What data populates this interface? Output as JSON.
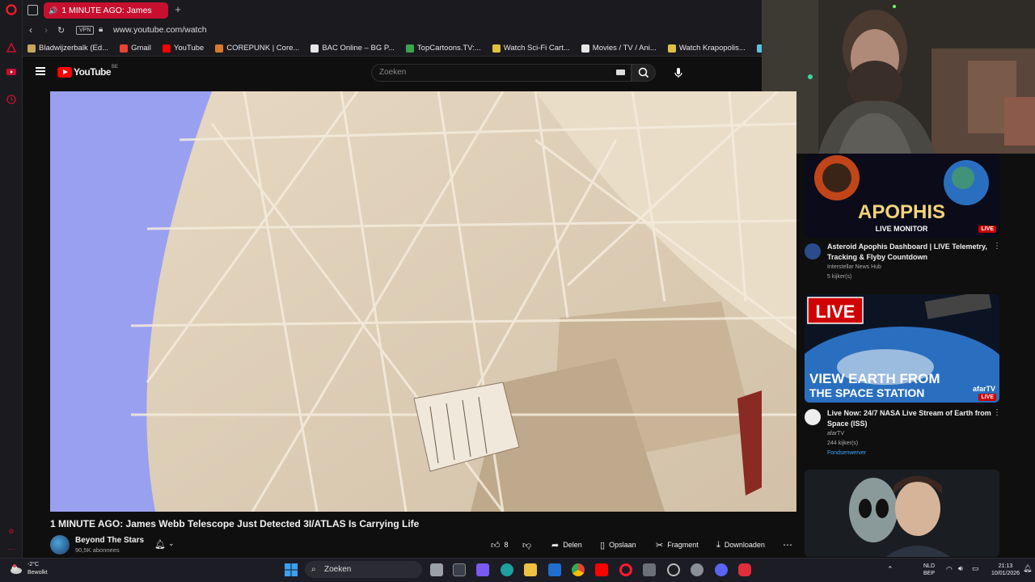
{
  "browser": {
    "active_tab_title": "1 MINUTE AGO: James",
    "new_tab_label": "+",
    "url": "www.youtube.com/watch",
    "vpn_label": "VPN"
  },
  "bookmarks": [
    {
      "label": "Bladwijzerbalk (Ed...",
      "color": "#c9a55c"
    },
    {
      "label": "Gmail",
      "color": "#ea4335"
    },
    {
      "label": "YouTube",
      "color": "#ff0000"
    },
    {
      "label": "COREPUNK | Core...",
      "color": "#d87a2a"
    },
    {
      "label": "BAC Online – BG P...",
      "color": "#e6e6e6"
    },
    {
      "label": "TopCartoons.TV:...",
      "color": "#3aa64c"
    },
    {
      "label": "Watch Sci-Fi Cart...",
      "color": "#e0c040"
    },
    {
      "label": "Movies / TV / Ani...",
      "color": "#e6e6e6"
    },
    {
      "label": "Watch Krapopolis...",
      "color": "#e0c040"
    },
    {
      "label": "Zamnesia | Het Be",
      "color": "#5cc0e0"
    }
  ],
  "youtube": {
    "logo_text": "YouTube",
    "region": "BE",
    "search_placeholder": "Zoeken"
  },
  "video": {
    "title": "1 MINUTE AGO: James Webb Telescope Just Detected 3I/ATLAS Is Carrying Life",
    "channel_name": "Beyond The Stars",
    "subscribers": "90,5K abonnees",
    "likes": "8",
    "actions": {
      "share": "Delen",
      "save": "Opslaan",
      "clip": "Fragment",
      "download": "Downloaden"
    }
  },
  "recommendations": [
    {
      "thumb_text": "APOPHIS",
      "thumb_subtext": "LIVE MONITOR",
      "live_label": "LIVE",
      "title": "Asteroid Apophis Dashboard | LIVE Telemetry, Tracking & Flyby Countdown",
      "channel": "Interstellar News Hub",
      "meta": "5 kijker(s)"
    },
    {
      "thumb_badge": "LIVE",
      "thumb_text": "VIEW EARTH FROM",
      "thumb_subtext": "THE SPACE STATION",
      "thumb_logo": "afarTV",
      "live_label": "LIVE",
      "title": "Live Now: 24/7 NASA Live Stream of Earth from Space (ISS)",
      "channel": "afarTV",
      "meta": "244 kijker(s)",
      "extra": "Fondsenwerver"
    }
  ],
  "taskbar": {
    "temperature": "-2°C",
    "weather": "Bewolkt",
    "search_label": "Zoeken",
    "language_top": "NLD",
    "language_bottom": "BEP",
    "time": "21:13",
    "date": "10/01/2026"
  }
}
